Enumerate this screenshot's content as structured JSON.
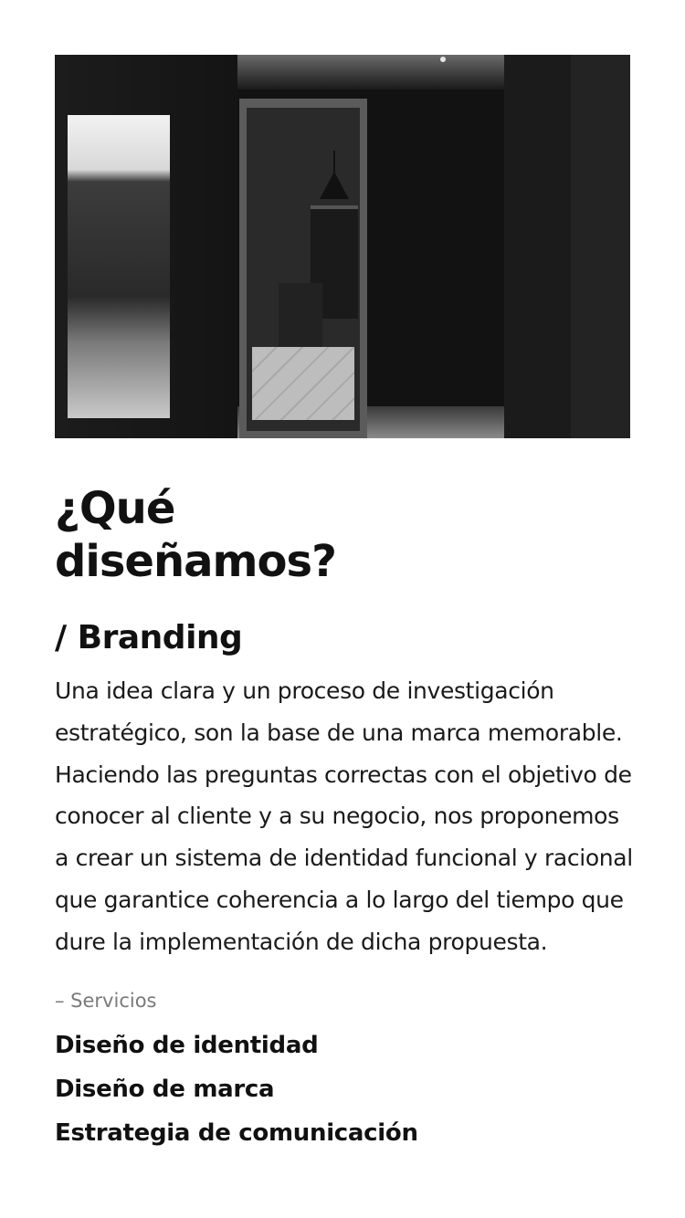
{
  "hero": {
    "icon": "photo-image"
  },
  "section": {
    "title": "¿Qué diseñamos?",
    "subtitle": "/ Branding",
    "description": "Una idea clara y un proceso de investigación estratégico, son la base de una marca memorable. Haciendo las preguntas correctas con el objetivo de conocer al cliente y a su negocio, nos proponemos a crear un sistema de identidad funcional y racional que garantice coherencia a lo largo del tiempo que dure la implementación de dicha propuesta.",
    "services_label": "– Servicios",
    "services": [
      "Diseño de identidad",
      "Diseño de marca",
      "Estrategia de comunicación"
    ]
  }
}
